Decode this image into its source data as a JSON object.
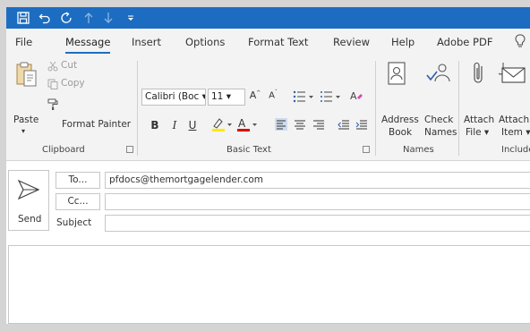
{
  "quick_access": {
    "icons": [
      "save-icon",
      "undo-icon",
      "redo-icon",
      "up-arrow-icon",
      "down-arrow-icon",
      "customize-dropdown-icon"
    ]
  },
  "tabs": [
    {
      "label": "File"
    },
    {
      "label": "Message",
      "active": true
    },
    {
      "label": "Insert"
    },
    {
      "label": "Options"
    },
    {
      "label": "Format Text"
    },
    {
      "label": "Review"
    },
    {
      "label": "Help"
    },
    {
      "label": "Adobe PDF"
    }
  ],
  "ribbon": {
    "clipboard": {
      "paste": "Paste",
      "cut": "Cut",
      "copy": "Copy",
      "format_painter": "Format Painter",
      "label": "Clipboard"
    },
    "basic_text": {
      "font_name": "Calibri (Boc",
      "font_size": "11",
      "bold": "B",
      "italic": "I",
      "underline": "U",
      "label": "Basic Text"
    },
    "names": {
      "address_book_line1": "Address",
      "address_book_line2": "Book",
      "check_names_line1": "Check",
      "check_names_line2": "Names",
      "label": "Names"
    },
    "include": {
      "attach_file_line1": "Attach",
      "attach_file_line2": "File",
      "attach_item_line1": "Attach",
      "attach_item_line2": "Item",
      "label": "Include"
    }
  },
  "compose": {
    "send": "Send",
    "to_button": "To...",
    "cc_button": "Cc...",
    "subject_label": "Subject",
    "to_value": "pfdocs@themortgagelender.com",
    "cc_value": "",
    "subject_value": ""
  },
  "colors": {
    "title_bar": "#1c6dc2",
    "highlight": "#ffe800",
    "font_color": "#e00000"
  }
}
